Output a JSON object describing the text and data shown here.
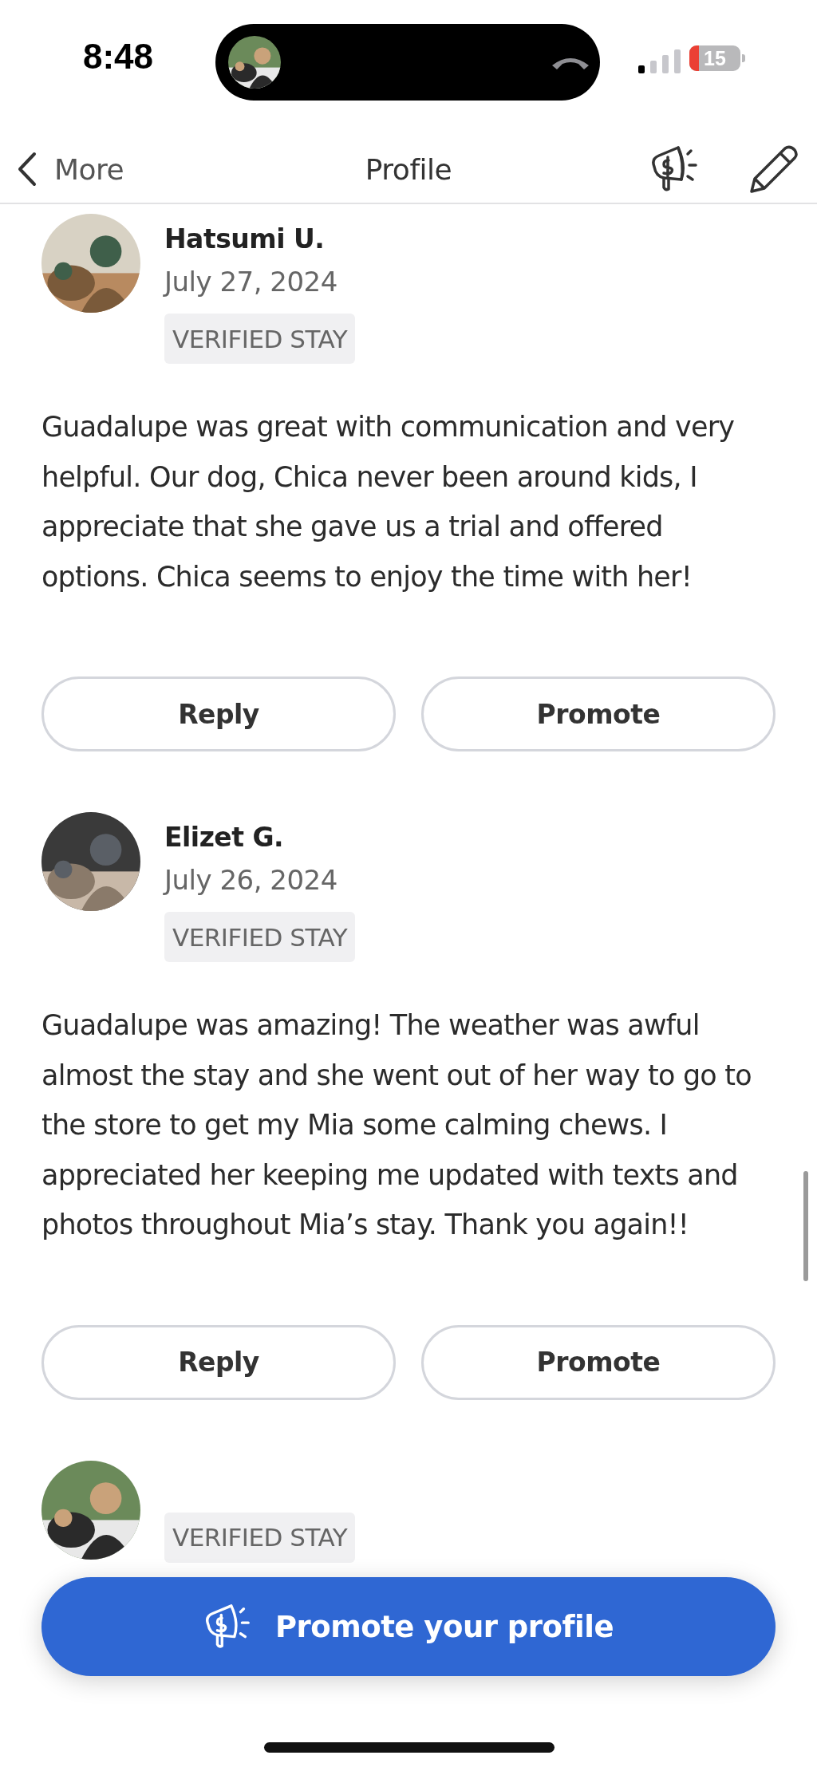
{
  "status_bar": {
    "time": "8:48",
    "battery": "15"
  },
  "nav": {
    "back_label": "More",
    "title": "Profile"
  },
  "reviews": [
    {
      "name": "Hatsumi U.",
      "date": "July 27, 2024",
      "badge": "VERIFIED STAY",
      "text": "Guadalupe was great with communication and very helpful. Our dog, Chica never been around kids, I appreciate that she gave us a trial and offered options. Chica seems to enjoy the time with her!",
      "actions": [
        "Reply",
        "Promote"
      ]
    },
    {
      "name": "Elizet G.",
      "date": "July 26, 2024",
      "badge": "VERIFIED STAY",
      "text": "Guadalupe was amazing! The weather was awful almost the stay and she went out of her way to go to the store to get my Mia some calming chews. I appreciated her keeping me updated with texts and photos throughout Mia’s stay. Thank you again!!",
      "actions": [
        "Reply",
        "Promote"
      ]
    },
    {
      "badge": "VERIFIED STAY"
    }
  ],
  "promote_button": {
    "label": "Promote your profile"
  }
}
